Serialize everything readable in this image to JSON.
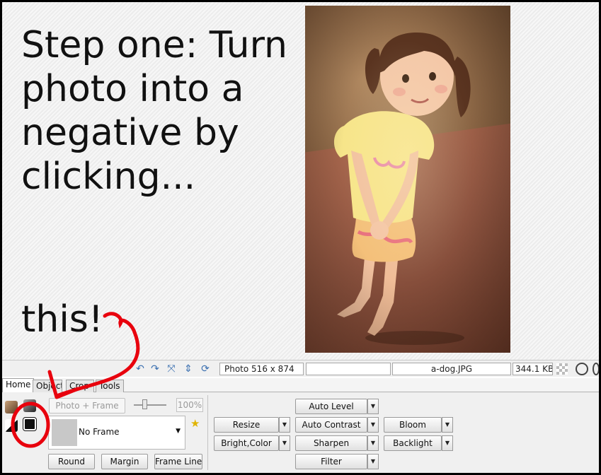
{
  "instruction": {
    "main": "Step one: Turn photo into a negative by clicking...",
    "tail": "this!"
  },
  "photo": {
    "alt_icon": "photo-canvas"
  },
  "status_bar": {
    "photo_info": "Photo 516 x 874",
    "blank_field": "",
    "filename": "a-dog.JPG",
    "filesize": "344.1 KB"
  },
  "tabs": [
    {
      "label": "Home",
      "active": true
    },
    {
      "label": "Object",
      "active": false
    },
    {
      "label": "Crop",
      "active": false
    },
    {
      "label": "Tools",
      "active": false
    }
  ],
  "panel": {
    "photo_frame_label": "Photo + Frame",
    "percent": "100%",
    "frame_select": "No Frame",
    "round": "Round",
    "margin": "Margin",
    "frame_line": "Frame Line",
    "resize": "Resize",
    "bright_color": "Bright,Color",
    "auto_level": "Auto Level",
    "auto_contrast": "Auto Contrast",
    "sharpen": "Sharpen",
    "filter": "Filter",
    "bloom": "Bloom",
    "backlight": "Backlight"
  },
  "colors": {
    "annotation_red": "#e8000d",
    "accent_blue": "#3a6fb0"
  }
}
